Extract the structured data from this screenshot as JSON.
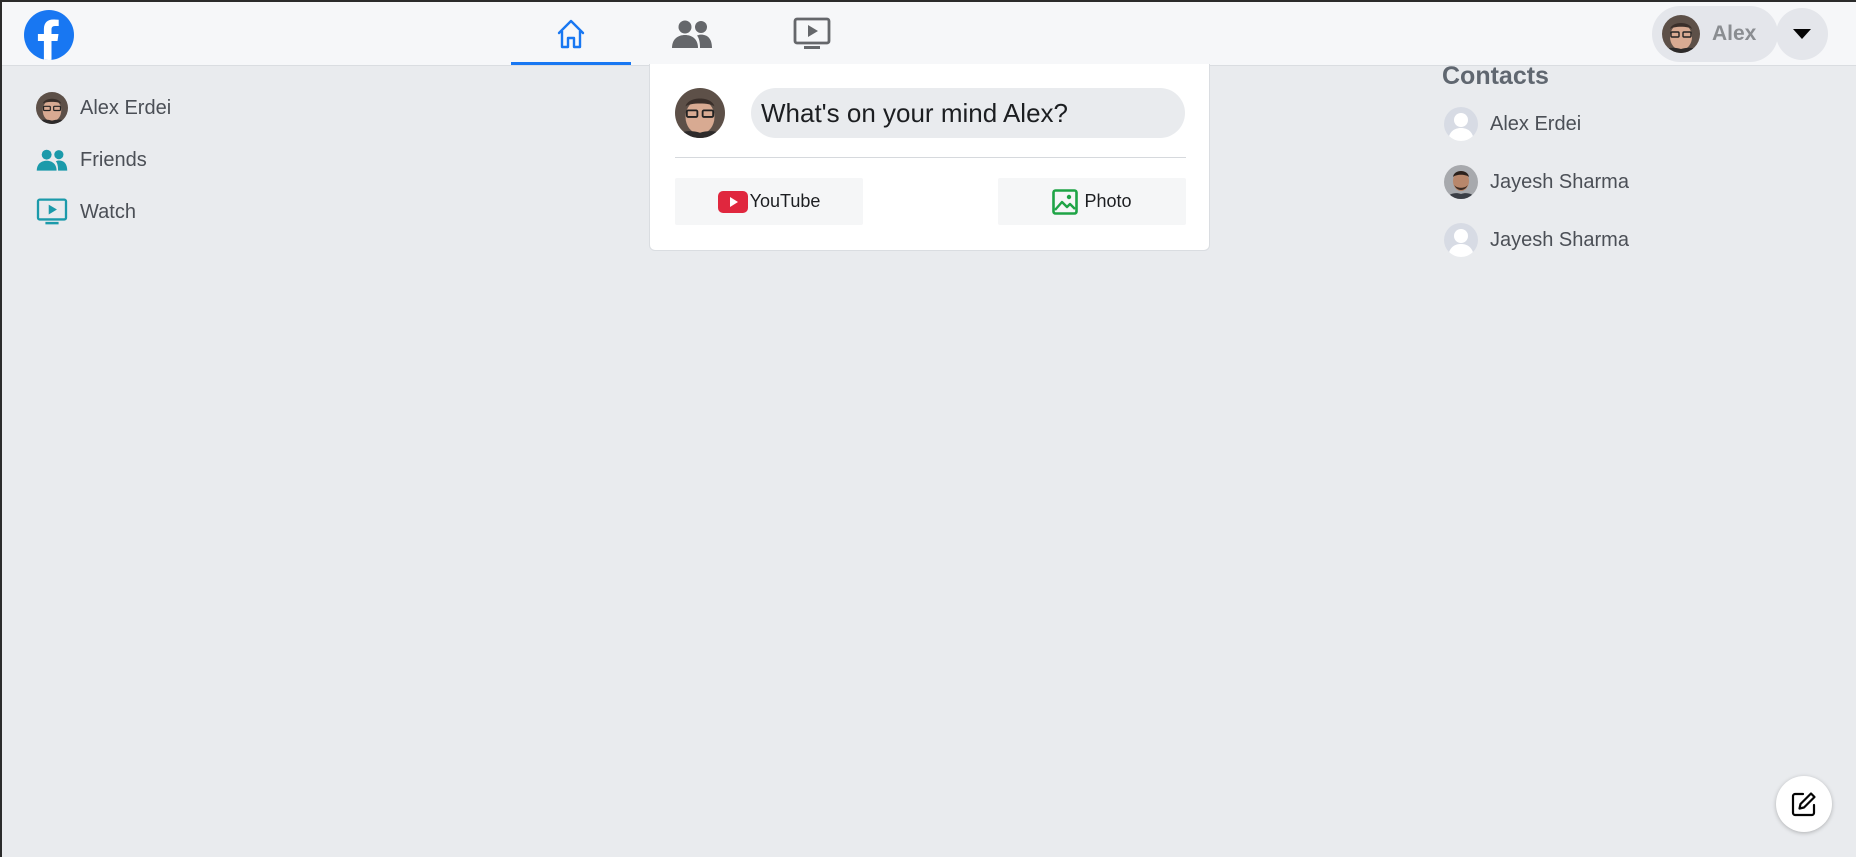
{
  "topbar": {
    "logo_icon": "facebook-logo-icon",
    "tabs": [
      {
        "icon": "home-icon",
        "active": true
      },
      {
        "icon": "friends-icon",
        "active": false
      },
      {
        "icon": "watch-icon",
        "active": false
      }
    ],
    "user_name": "Alex",
    "menu_icon": "caret-down-icon"
  },
  "sidebar": {
    "items": [
      {
        "label": "Alex Erdei",
        "icon": "avatar"
      },
      {
        "label": "Friends",
        "icon": "friends-icon"
      },
      {
        "label": "Watch",
        "icon": "watch-icon"
      }
    ]
  },
  "composer": {
    "placeholder": "What's on your mind Alex?",
    "youtube_label": "YouTube",
    "photo_label": "Photo"
  },
  "contacts": {
    "title": "Contacts",
    "items": [
      {
        "name": "Alex Erdei",
        "avatar": "default"
      },
      {
        "name": "Jayesh Sharma",
        "avatar": "photo"
      },
      {
        "name": "Jayesh Sharma",
        "avatar": "default"
      }
    ]
  },
  "colors": {
    "brand": "#1877f2",
    "accent_teal": "#1b9aaa",
    "youtube_red": "#e0273e",
    "photo_green": "#1ea446",
    "background": "#e9ebee"
  }
}
